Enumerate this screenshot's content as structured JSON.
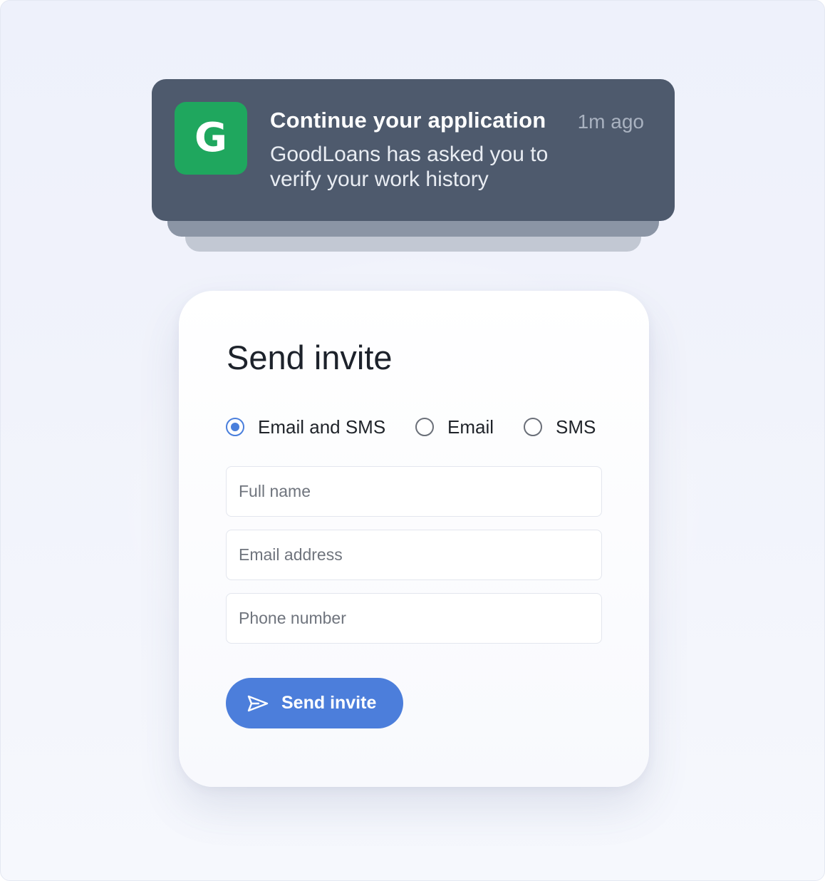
{
  "notification": {
    "app_icon_letter": "G",
    "app_icon_color": "#1fa75e",
    "title": "Continue your application",
    "time": "1m ago",
    "body": "GoodLoans has asked you to verify your work history"
  },
  "invite": {
    "title": "Send invite",
    "delivery_options": [
      {
        "label": "Email and SMS",
        "selected": true
      },
      {
        "label": "Email",
        "selected": false
      },
      {
        "label": "SMS",
        "selected": false
      }
    ],
    "fields": {
      "full_name": {
        "placeholder": "Full name",
        "value": ""
      },
      "email": {
        "placeholder": "Email address",
        "value": ""
      },
      "phone": {
        "placeholder": "Phone number",
        "value": ""
      }
    },
    "send_button": {
      "label": "Send invite",
      "icon": "send-icon"
    },
    "accent_color": "#4c7edb"
  }
}
